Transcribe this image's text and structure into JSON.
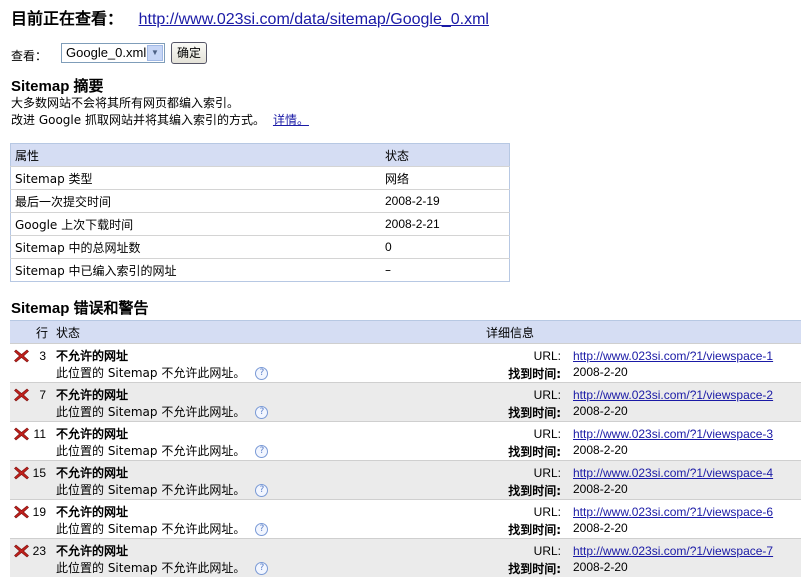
{
  "header": {
    "label": "目前正在查看：",
    "url": "http://www.023si.com/data/sitemap/Google_0.xml"
  },
  "viewer": {
    "label": "查看：",
    "selected": "Google_0.xml",
    "button": "确定"
  },
  "summary": {
    "title": "Sitemap 摘要",
    "line1": "大多数网站不会将其所有网页都编入索引。",
    "line2": "改进 Google 抓取网站并将其编入索引的方式。",
    "more_link": "详情。",
    "columns": [
      "属性",
      "状态"
    ],
    "rows": [
      {
        "prop": "Sitemap 类型",
        "status": "网络"
      },
      {
        "prop": "最后一次提交时间",
        "status": "2008-2-19"
      },
      {
        "prop": "Google 上次下载时间",
        "status": "2008-2-21"
      },
      {
        "prop": "Sitemap 中的总网址数",
        "status": "0"
      },
      {
        "prop": "Sitemap 中已编入索引的网址",
        "status": "–"
      }
    ]
  },
  "errors": {
    "title": "Sitemap 错误和警告",
    "columns": {
      "row": "行",
      "status": "状态",
      "detail": "详细信息"
    },
    "url_label": "URL:",
    "found_label": "找到时间:",
    "items": [
      {
        "line": "3",
        "title": "不允许的网址",
        "sub": "此位置的 Sitemap 不允许此网址。",
        "url": "http://www.023si.com/?1/viewspace-1",
        "date": "2008-2-20"
      },
      {
        "line": "7",
        "title": "不允许的网址",
        "sub": "此位置的 Sitemap 不允许此网址。",
        "url": "http://www.023si.com/?1/viewspace-2",
        "date": "2008-2-20"
      },
      {
        "line": "11",
        "title": "不允许的网址",
        "sub": "此位置的 Sitemap 不允许此网址。",
        "url": "http://www.023si.com/?1/viewspace-3",
        "date": "2008-2-20"
      },
      {
        "line": "15",
        "title": "不允许的网址",
        "sub": "此位置的 Sitemap 不允许此网址。",
        "url": "http://www.023si.com/?1/viewspace-4",
        "date": "2008-2-20"
      },
      {
        "line": "19",
        "title": "不允许的网址",
        "sub": "此位置的 Sitemap 不允许此网址。",
        "url": "http://www.023si.com/?1/viewspace-6",
        "date": "2008-2-20"
      },
      {
        "line": "23",
        "title": "不允许的网址",
        "sub": "此位置的 Sitemap 不允许此网址。",
        "url": "http://www.023si.com/?1/viewspace-7",
        "date": "2008-2-20"
      }
    ]
  },
  "colors": {
    "link": "#1a1aa6",
    "header_bg": "#d5ddf3",
    "alt_row": "#ebebeb",
    "error_icon": "#c0201c"
  },
  "icons": {
    "error": "red-x-icon",
    "help": "question-help-icon",
    "dropdown": "chevron-down-icon"
  }
}
